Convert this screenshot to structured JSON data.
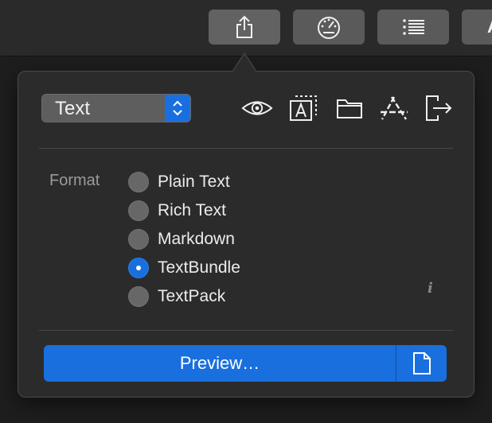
{
  "toolbar": {
    "partial_label": "A"
  },
  "export": {
    "type_select": {
      "value": "Text"
    },
    "format": {
      "label": "Format",
      "options": [
        {
          "label": "Plain Text",
          "selected": false
        },
        {
          "label": "Rich Text",
          "selected": false
        },
        {
          "label": "Markdown",
          "selected": false
        },
        {
          "label": "TextBundle",
          "selected": true
        },
        {
          "label": "TextPack",
          "selected": false
        }
      ]
    },
    "info_glyph": "i",
    "preview_button": "Preview…"
  },
  "icons": {
    "toolbar": [
      "share-icon",
      "gauge-icon",
      "list-icon"
    ],
    "row": [
      "eye-icon",
      "text-box-icon",
      "folder-icon",
      "app-store-icon",
      "export-icon"
    ],
    "doc": "document-icon"
  },
  "colors": {
    "accent": "#1a6fde",
    "popover_bg": "#2b2b2b",
    "toolbar_button": "#5a5a5a"
  }
}
